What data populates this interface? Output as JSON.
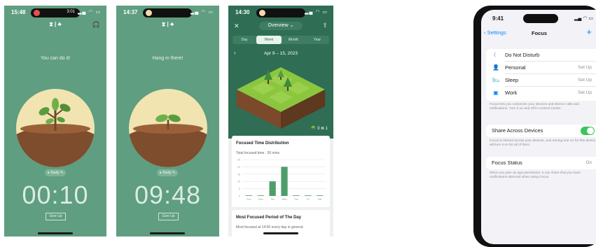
{
  "screen1": {
    "time": "15:48",
    "island_text": "3:01",
    "mode_icons": "⧗ | ♣",
    "motivation": "You can do it!",
    "tag": "● Study ✎",
    "timer": "00:10",
    "give_up": "Give Up"
  },
  "screen2": {
    "time": "14:37",
    "mode_icons": "⧗ | ♣",
    "motivation": "Hang in there!",
    "tag": "● Study ✎",
    "timer": "09:48",
    "give_up": "Give Up"
  },
  "screen3": {
    "time": "14:30",
    "title": "Overview ⌄",
    "tabs": [
      "Day",
      "Week",
      "Month",
      "Year"
    ],
    "active_tab": 1,
    "date_range": "Apr 9 – 15, 2023",
    "stats": "🌳 3  ⊗ 1",
    "card1_title": "Focused Time Distribution",
    "card1_sub": "Total focused time : 30 mins",
    "card2_title": "Most Focused Period of The Day",
    "card2_sub": "Most focused at 14:00 every day in general",
    "chart_data": {
      "type": "bar",
      "categories": [
        "Sun",
        "Mon",
        "Tue",
        "Wed",
        "Thu",
        "Fri",
        "Sat"
      ],
      "values": [
        0,
        0,
        10,
        20,
        0,
        0,
        0
      ],
      "ylim": [
        0,
        25
      ],
      "yticks": [
        "0",
        "5",
        "10",
        "15",
        "20",
        "25"
      ],
      "bar_color": "#4e9e6c",
      "grid": true
    }
  },
  "screen4": {
    "time": "9:41",
    "back": "Settings",
    "title": "Focus",
    "add": "+",
    "items": [
      {
        "label": "Do Not Disturb",
        "value": "",
        "icon": "☾",
        "icon_color": "#5e5ce6",
        "name": "do-not-disturb"
      },
      {
        "label": "Personal",
        "value": "Set Up",
        "icon": "👤",
        "icon_color": "#af52de",
        "name": "personal"
      },
      {
        "label": "Sleep",
        "value": "Set Up",
        "icon": "🛏",
        "icon_color": "#30b0c7",
        "name": "sleep"
      },
      {
        "label": "Work",
        "value": "Set Up",
        "icon": "▣",
        "icon_color": "#0a84ff",
        "name": "work"
      }
    ],
    "note1": "Focus lets you customize your devices and silence calls and notifications. Turn it on and off in Control Center.",
    "share_label": "Share Across Devices",
    "note2": "Focus is shared across your devices, and turning one on for this device will turn it on for all of them.",
    "status_label": "Focus Status",
    "status_value": "On",
    "note3": "When you give an app permission, it can share that you have notifications silenced when using Focus."
  }
}
